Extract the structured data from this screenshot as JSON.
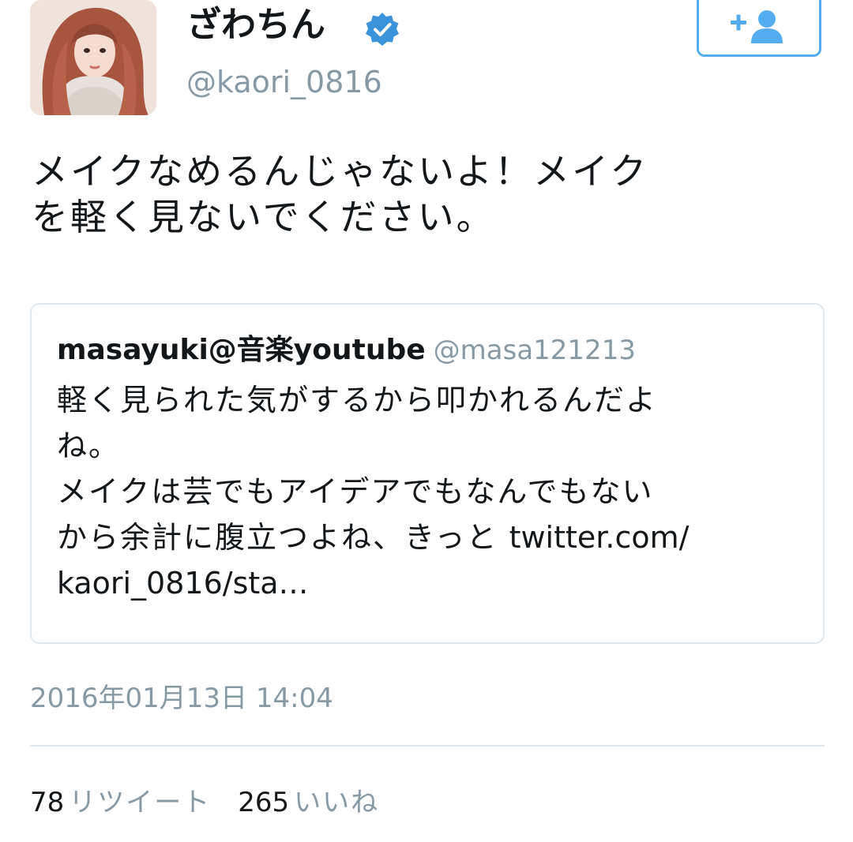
{
  "author": {
    "display_name": "ざわちん",
    "handle": "@kaori_0816",
    "verified_icon": "verified-badge-icon",
    "avatar_icon": "profile-photo"
  },
  "follow_button": {
    "icon": "add-user-icon",
    "color": "#55acee"
  },
  "tweet": {
    "text": "メイクなめるんじゃないよ！メイク\nを軽く見ないでください。"
  },
  "quoted_tweet": {
    "name": "masayuki@音楽youtube",
    "handle": "@masa121213",
    "lines": [
      "軽く見られた気がするから叩かれるんだよ",
      "ね。",
      "メイクは芸でもアイデアでもなんでもない",
      "から余計に腹立つよね、きっと "
    ],
    "link_part1": "twitter.com/",
    "link_part2": "kaori_0816/sta…"
  },
  "timestamp": "2016年01月13日 14:04",
  "stats": {
    "retweets_count": "78",
    "retweets_label": "リツイート",
    "likes_count": "265",
    "likes_label": "いいね"
  },
  "colors": {
    "text": "#14171a",
    "secondary": "#8899a6",
    "accent": "#55acee",
    "border": "#e1e8ed"
  }
}
